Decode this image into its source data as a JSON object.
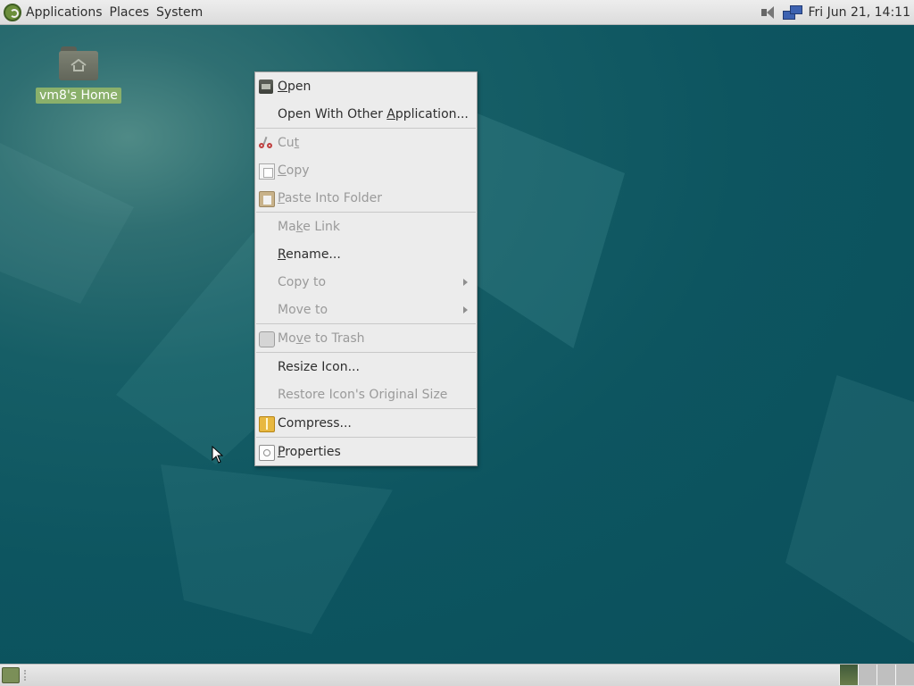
{
  "top_panel": {
    "menus": [
      "Applications",
      "Places",
      "System"
    ],
    "clock": "Fri Jun 21, 14:11",
    "tray_icons": [
      "volume-icon",
      "network-icon"
    ]
  },
  "desktop": {
    "icons": [
      {
        "label": "vm8's Home",
        "icon": "home-folder-icon"
      }
    ]
  },
  "context_menu": {
    "items": [
      {
        "label_pre": "",
        "label_u": "O",
        "label_post": "pen",
        "enabled": true,
        "icon": "open-folder-icon"
      },
      {
        "label_pre": "Open With Other ",
        "label_u": "A",
        "label_post": "pplication...",
        "enabled": true,
        "icon": ""
      },
      {
        "label_pre": "Cu",
        "label_u": "t",
        "label_post": "",
        "enabled": false,
        "icon": "cut-icon"
      },
      {
        "label_pre": "",
        "label_u": "C",
        "label_post": "opy",
        "enabled": false,
        "icon": "copy-icon"
      },
      {
        "label_pre": "",
        "label_u": "P",
        "label_post": "aste Into Folder",
        "enabled": false,
        "icon": "paste-icon"
      },
      {
        "label_pre": "Ma",
        "label_u": "k",
        "label_post": "e Link",
        "enabled": false,
        "icon": ""
      },
      {
        "label_pre": "",
        "label_u": "R",
        "label_post": "ename...",
        "enabled": true,
        "icon": ""
      },
      {
        "label_pre": "Copy to",
        "label_u": "",
        "label_post": "",
        "enabled": false,
        "icon": "",
        "submenu": true
      },
      {
        "label_pre": "Move to",
        "label_u": "",
        "label_post": "",
        "enabled": false,
        "icon": "",
        "submenu": true
      },
      {
        "label_pre": "Mo",
        "label_u": "v",
        "label_post": "e to Trash",
        "enabled": false,
        "icon": "trash-icon"
      },
      {
        "label_pre": "Resize Icon...",
        "label_u": "",
        "label_post": "",
        "enabled": true,
        "icon": ""
      },
      {
        "label_pre": "Restore Icon's Original Size",
        "label_u": "",
        "label_post": "",
        "enabled": false,
        "icon": ""
      },
      {
        "label_pre": "Compress...",
        "label_u": "",
        "label_post": "",
        "enabled": true,
        "icon": "compress-icon"
      },
      {
        "label_pre": "",
        "label_u": "P",
        "label_post": "roperties",
        "enabled": true,
        "icon": "properties-icon"
      }
    ]
  },
  "bottom_panel": {
    "workspaces": 4,
    "active_workspace": 1
  },
  "colors": {
    "desktop_bg": "#0d5560",
    "panel_bg": "#e3e3e3",
    "menu_bg": "#ececec",
    "selection_label_bg": "#8ab06b",
    "disabled_text": "#9a9a9a"
  }
}
